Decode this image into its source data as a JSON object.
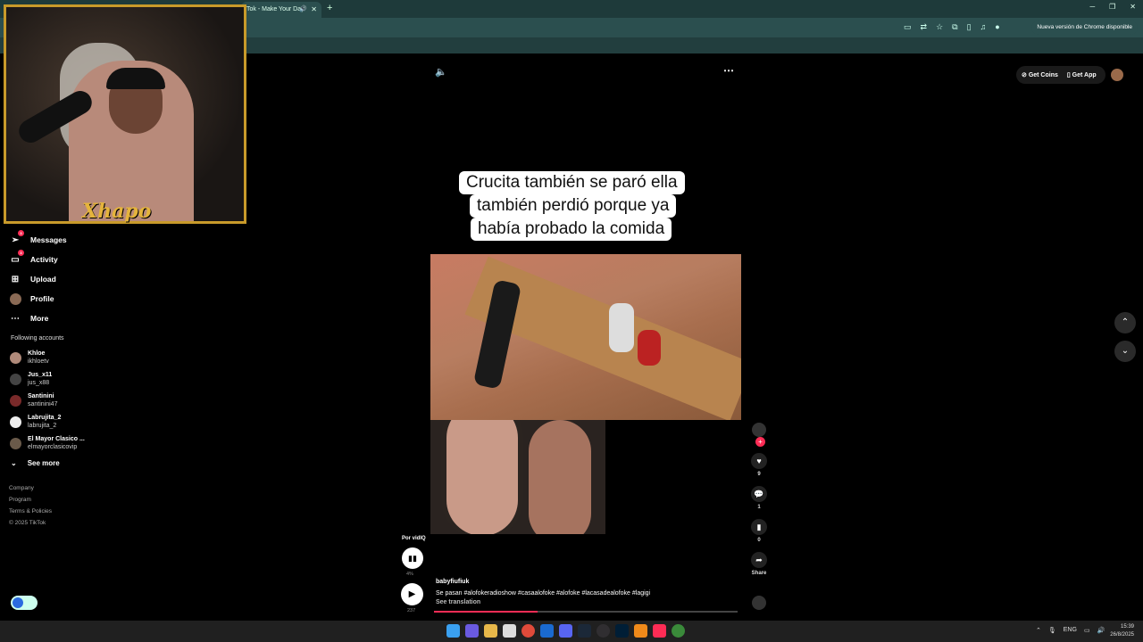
{
  "browser": {
    "tab_title": "Tok - Make Your Day",
    "new_tab": "+",
    "update_label": "Nueva versión de Chrome disponible"
  },
  "cam": {
    "brand": "Xhapo"
  },
  "sidebar": {
    "items": [
      {
        "label": "Messages",
        "icon": "paper-plane-icon",
        "badge": "3"
      },
      {
        "label": "Activity",
        "icon": "inbox-icon",
        "badge": "3"
      },
      {
        "label": "Upload",
        "icon": "plus-square-icon"
      },
      {
        "label": "Profile",
        "icon": "avatar"
      },
      {
        "label": "More",
        "icon": "ellipsis-icon"
      }
    ],
    "following_title": "Following accounts",
    "accounts": [
      {
        "name": "Khloe",
        "handle": "ikhloetv"
      },
      {
        "name": "Jus_x11",
        "handle": "jus_x88"
      },
      {
        "name": "Santinini",
        "handle": "santinini47"
      },
      {
        "name": "Labrujita_2",
        "handle": "labrujita_2"
      },
      {
        "name": "El Mayor Clasico ...",
        "handle": "elmayorclasicovip"
      }
    ],
    "see_more": "See more",
    "footer": [
      "Company",
      "Program",
      "Terms & Policies",
      "© 2025 TikTok"
    ]
  },
  "header": {
    "get_coins": "Get Coins",
    "get_app": "Get App"
  },
  "video": {
    "caption_lines": [
      "Crucita también se paró ella",
      "también perdió porque ya",
      "había probado la comida"
    ],
    "author": "babyfiufiuk",
    "description": "Se pasan #alofokeradioshow #casaalofoke #alofoke #lacasadealofoke #lagigi",
    "see_translation": "See translation",
    "progress": 0.34
  },
  "actions": {
    "likes": "9",
    "comments": "1",
    "saves": "0",
    "share_label": "Share"
  },
  "vidiq": {
    "label": "Por vidIQ",
    "percent": "4%",
    "count": "237"
  },
  "taskbar": {
    "lang": "ENG",
    "time": "15:39",
    "date": "26/8/2025"
  },
  "colors": {
    "accent": "#fe2c55",
    "chrome_bar": "#2b4f4f",
    "cam_border": "#c89a2a"
  }
}
